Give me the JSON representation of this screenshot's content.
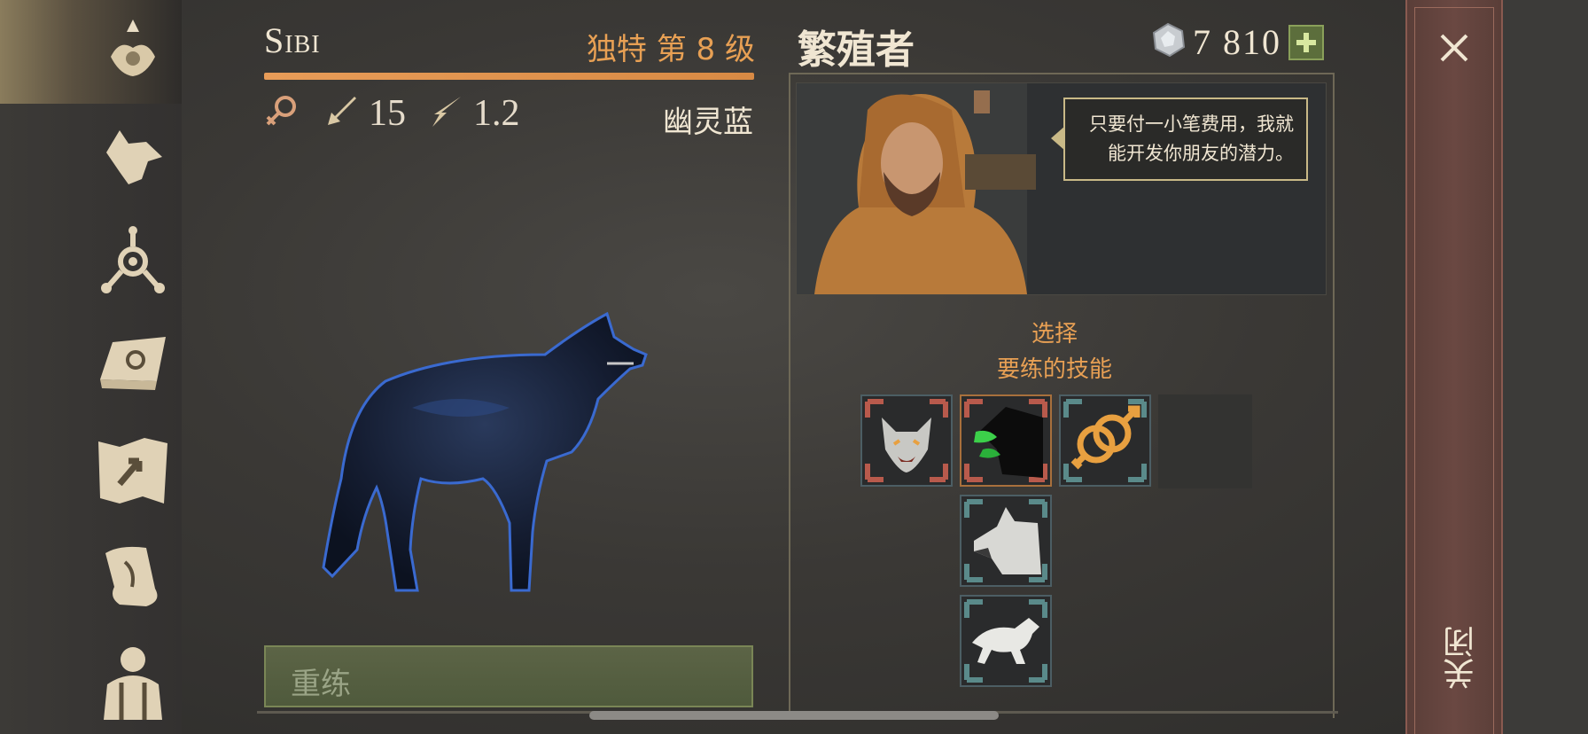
{
  "pet": {
    "name": "Sibi",
    "rank": "独特  第 8 级",
    "gender": "female",
    "attack": "15",
    "speed": "1.2",
    "coat": "幽灵蓝"
  },
  "retrain_button": "重练",
  "breeder": {
    "title": "繁殖者",
    "currency": "7  810",
    "speech": "只要付一小笔费用，我就能开发你朋友的潜力。"
  },
  "select_prompt": {
    "line1": "选择",
    "line2": "要练的技能"
  },
  "skills": [
    {
      "icon": "growling-wolf-icon",
      "selected": false
    },
    {
      "icon": "green-fang-wolf-icon",
      "selected": true
    },
    {
      "icon": "gender-symbol-icon",
      "selected": false
    },
    {
      "icon": "white-wolf-head-icon",
      "selected": false
    },
    {
      "icon": "running-wolf-icon",
      "selected": false
    }
  ],
  "close": {
    "label": "关闭"
  },
  "sidebar": [
    "pack-icon",
    "wolf-head-icon",
    "target-icon",
    "sun-book-icon",
    "map-icon",
    "scroll-icon",
    "character-icon"
  ],
  "colors": {
    "accent_orange": "#e8a054",
    "button_green": "#4f5a3c",
    "close_red": "#6a4842"
  }
}
